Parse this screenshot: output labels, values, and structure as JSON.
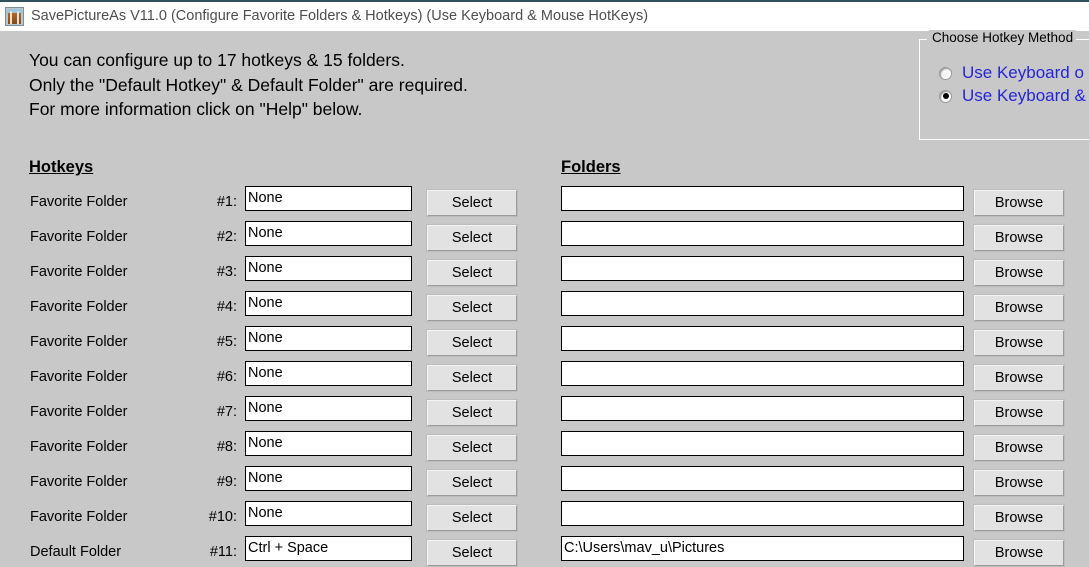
{
  "window": {
    "title": "SavePictureAs V11.0 (Configure Favorite Folders & Hotkeys) (Use Keyboard & Mouse HotKeys)",
    "icon": "picture-frame-icon"
  },
  "intro": {
    "line1": "You can configure up to 17 hotkeys & 15 folders.",
    "line2": "Only the \"Default Hotkey\" & Default Folder\" are required.",
    "line3": "For more information click on \"Help\" below."
  },
  "hotkey_method": {
    "legend": "Choose Hotkey Method",
    "options": [
      {
        "label": "Use Keyboard o",
        "checked": false
      },
      {
        "label": "Use Keyboard &",
        "checked": true
      }
    ]
  },
  "headings": {
    "hotkeys": "Hotkeys",
    "folders": "Folders"
  },
  "buttons": {
    "select": "Select",
    "browse": "Browse"
  },
  "rows": [
    {
      "label": "Favorite Folder",
      "num": "#1:",
      "hotkey": "None",
      "folder": ""
    },
    {
      "label": "Favorite Folder",
      "num": "#2:",
      "hotkey": "None",
      "folder": ""
    },
    {
      "label": "Favorite Folder",
      "num": "#3:",
      "hotkey": "None",
      "folder": ""
    },
    {
      "label": "Favorite Folder",
      "num": "#4:",
      "hotkey": "None",
      "folder": ""
    },
    {
      "label": "Favorite Folder",
      "num": "#5:",
      "hotkey": "None",
      "folder": ""
    },
    {
      "label": "Favorite Folder",
      "num": "#6:",
      "hotkey": "None",
      "folder": ""
    },
    {
      "label": "Favorite Folder",
      "num": "#7:",
      "hotkey": "None",
      "folder": ""
    },
    {
      "label": "Favorite Folder",
      "num": "#8:",
      "hotkey": "None",
      "folder": ""
    },
    {
      "label": "Favorite Folder",
      "num": "#9:",
      "hotkey": "None",
      "folder": ""
    },
    {
      "label": "Favorite Folder",
      "num": "#10:",
      "hotkey": "None",
      "folder": ""
    },
    {
      "label": "Default Folder",
      "num": "#11:",
      "hotkey": "Ctrl + Space",
      "folder": "C:\\Users\\mav_u\\Pictures"
    }
  ],
  "colors": {
    "client_background": "#c8c8c8",
    "titlebar_background": "#ffffff",
    "titlebar_accent": "#31525c",
    "title_text": "#4e4e4e",
    "radio_label": "#2525d8",
    "input_background": "#ffffff",
    "button_face": "#e2e2e2"
  }
}
